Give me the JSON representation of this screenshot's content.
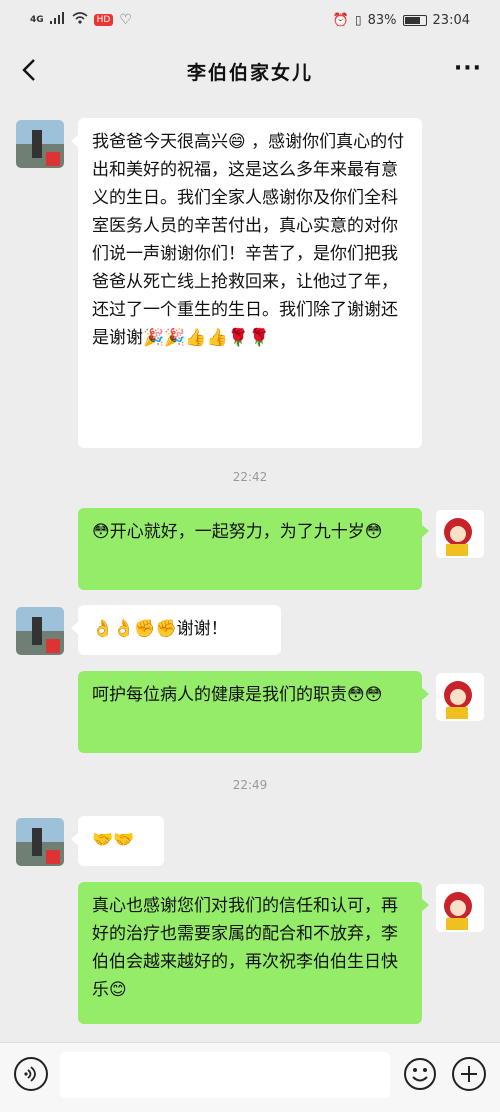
{
  "status_bar": {
    "network": "4G",
    "badge": "HD",
    "battery": "83%",
    "battery_level": 0.83,
    "time": "23:04"
  },
  "header": {
    "title": "李伯伯家女儿",
    "more": "···"
  },
  "messages": [
    {
      "side": "left",
      "text": "我爸爸今天很高兴😄 ，感谢你们真心的付出和美好的祝福，这是这么多年来最有意义的生日。我们全家人感谢你及你们全科室医务人员的辛苦付出，真心实意的对你们说一声谢谢你们！辛苦了，是你们把我爸爸从死亡线上抢救回来，让他过了年，还过了一个重生的生日。我们除了谢谢还是谢谢🎉🎉👍👍🌹🌹"
    },
    {
      "side": "right",
      "text": "😳开心就好，一起努力，为了九十岁😳"
    },
    {
      "side": "left",
      "text": "👌👌✊✊谢谢！"
    },
    {
      "side": "right",
      "text": "呵护每位病人的健康是我们的职责😳😳"
    },
    {
      "side": "left",
      "text": "🤝🤝"
    },
    {
      "side": "right",
      "text": "真心也感谢您们对我们的信任和认可，再好的治疗也需要家属的配合和不放弃，李伯伯会越来越好的，再次祝李伯伯生日快乐😊"
    }
  ],
  "timestamps": [
    "22:42",
    "22:49"
  ]
}
